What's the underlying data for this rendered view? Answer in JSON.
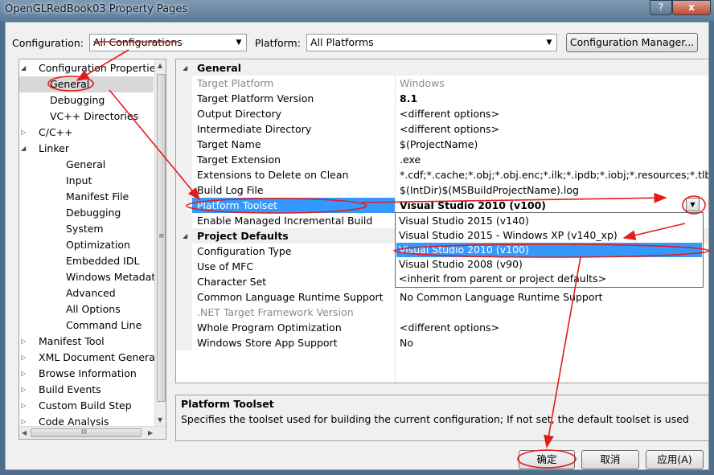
{
  "window": {
    "title": "OpenGLRedBook03 Property Pages",
    "help_label": "?",
    "close_label": "x"
  },
  "toolbar": {
    "configuration_label": "Configuration:",
    "configuration_value": "All Configurations",
    "platform_label": "Platform:",
    "platform_value": "All Platforms",
    "config_manager_label": "Configuration Manager..."
  },
  "tree": {
    "items": [
      {
        "label": "Configuration Properties",
        "expander": "◢"
      },
      {
        "label": "General"
      },
      {
        "label": "Debugging"
      },
      {
        "label": "VC++ Directories"
      },
      {
        "label": "C/C++",
        "expander": "▷"
      },
      {
        "label": "Linker",
        "expander": "◢"
      },
      {
        "label": "General"
      },
      {
        "label": "Input"
      },
      {
        "label": "Manifest File"
      },
      {
        "label": "Debugging"
      },
      {
        "label": "System"
      },
      {
        "label": "Optimization"
      },
      {
        "label": "Embedded IDL"
      },
      {
        "label": "Windows Metadata"
      },
      {
        "label": "Advanced"
      },
      {
        "label": "All Options"
      },
      {
        "label": "Command Line"
      },
      {
        "label": "Manifest Tool",
        "expander": "▷"
      },
      {
        "label": "XML Document Generator",
        "expander": "▷"
      },
      {
        "label": "Browse Information",
        "expander": "▷"
      },
      {
        "label": "Build Events",
        "expander": "▷"
      },
      {
        "label": "Custom Build Step",
        "expander": "▷"
      },
      {
        "label": "Code Analysis",
        "expander": "▷"
      }
    ],
    "scroll_left_arrow": "◀",
    "scroll_right_arrow": "▶",
    "scroll_up_arrow": "▲",
    "scroll_down_arrow": "▼",
    "hgrip": "III",
    "vgrip": "≡"
  },
  "grid": {
    "rows": [
      {
        "name": "General",
        "category": true,
        "expander": "◢"
      },
      {
        "name": "Target Platform",
        "value": "Windows",
        "gray": true
      },
      {
        "name": "Target Platform Version",
        "value": "8.1",
        "bold": true
      },
      {
        "name": "Output Directory",
        "value": "<different options>"
      },
      {
        "name": "Intermediate Directory",
        "value": "<different options>"
      },
      {
        "name": "Target Name",
        "value": "$(ProjectName)"
      },
      {
        "name": "Target Extension",
        "value": ".exe"
      },
      {
        "name": "Extensions to Delete on Clean",
        "value": "*.cdf;*.cache;*.obj;*.obj.enc;*.ilk;*.ipdb;*.iobj;*.resources;*.tlb;*.tli;*.t"
      },
      {
        "name": "Build Log File",
        "value": "$(IntDir)$(MSBuildProjectName).log"
      },
      {
        "name": "Platform Toolset",
        "value": "Visual Studio 2010 (v100)",
        "bold": true,
        "selected": true
      },
      {
        "name": "Enable Managed Incremental Build",
        "value": ""
      },
      {
        "name": "Project Defaults",
        "category": true,
        "expander": "◢"
      },
      {
        "name": "Configuration Type",
        "value": ""
      },
      {
        "name": "Use of MFC",
        "value": ""
      },
      {
        "name": "Character Set",
        "value": ""
      },
      {
        "name": "Common Language Runtime Support",
        "value": "No Common Language Runtime Support"
      },
      {
        "name": ".NET Target Framework Version",
        "value": "",
        "gray": true
      },
      {
        "name": "Whole Program Optimization",
        "value": "<different options>"
      },
      {
        "name": "Windows Store App Support",
        "value": "No"
      }
    ],
    "dropdown_arrow": "▼",
    "toolset_options": [
      {
        "label": "Visual Studio 2015 (v140)"
      },
      {
        "label": "Visual Studio 2015 - Windows XP (v140_xp)"
      },
      {
        "label": "Visual Studio 2010 (v100)",
        "selected": true
      },
      {
        "label": "Visual Studio 2008 (v90)"
      },
      {
        "label": "<inherit from parent or project defaults>"
      }
    ]
  },
  "description": {
    "title": "Platform Toolset",
    "text": "Specifies the toolset used for building the current configuration; If not set, the default toolset is used"
  },
  "buttons": {
    "ok_label": "确定",
    "cancel_label": "取消",
    "apply_label": "应用(A)"
  },
  "annotation_color": "#e31b1b"
}
